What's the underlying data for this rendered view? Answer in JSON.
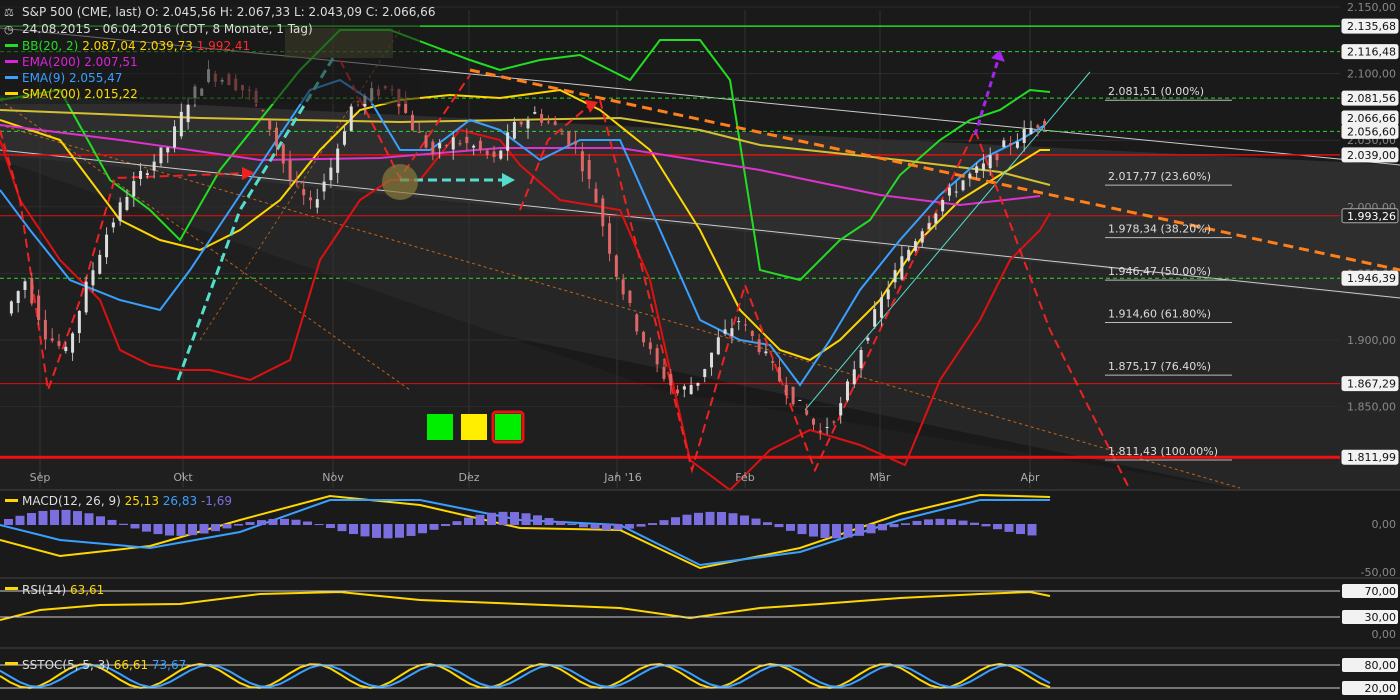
{
  "header": {
    "line1": "S&P 500 (CME, last)  O: 2.045,56  H: 2.067,33  L: 2.043,09  C: 2.066,66",
    "line2": "24.08.2015 - 06.04.2016 (CDT, 8 Monate, 1 Tag)",
    "legend": [
      {
        "label": "BB(20, 2)",
        "values": [
          "2.087,04",
          "2.039,73",
          "1.992,41"
        ],
        "colors": [
          "#ffd700",
          "#ffd700",
          "#ff2a2a"
        ],
        "swatch": "#22dd22"
      },
      {
        "label": "EMA(200)",
        "values": [
          "2.007,51"
        ],
        "colors": [
          "#dd22dd"
        ],
        "swatch": "#dd22dd"
      },
      {
        "label": "EMA(9)",
        "values": [
          "2.055,47"
        ],
        "colors": [
          "#3aa0ff"
        ],
        "swatch": "#3aa0ff"
      },
      {
        "label": "SMA(200)",
        "values": [
          "2.015,22"
        ],
        "colors": [
          "#ffd700"
        ],
        "swatch": "#ffd700"
      }
    ]
  },
  "colors": {
    "background": "#1a1a1a",
    "channel": "#3a3a3a",
    "bb_outer": "#22dd22",
    "bb_lower": "#dd1111",
    "ema9": "#3aa0ff",
    "ema200": "#dd33cc",
    "sma200": "#ffd700",
    "candle_up": "#bbbbbb",
    "candle_down": "#dd6666",
    "resistance_red": "#dd1111",
    "fib_green": "#33cc33",
    "trend_orange": "#ff7f1a",
    "arrow_cyan": "#55ddcc",
    "arrow_red": "#ee2222",
    "arrow_purple": "#aa22ee"
  },
  "axis": {
    "months": [
      "Sep",
      "Okt",
      "Nov",
      "Dez",
      "Jan '16",
      "Feb",
      "Mär",
      "Apr"
    ],
    "price_ticks": [
      "2.150,00",
      "2.100,00",
      "2.050,00",
      "2.000,00",
      "1.950,00",
      "1.900,00",
      "1.850,00"
    ],
    "price_tags": [
      {
        "label": "2.135,68",
        "style": "white"
      },
      {
        "label": "2.116,48",
        "style": "white"
      },
      {
        "label": "2.081,56",
        "style": "white"
      },
      {
        "label": "2.066,66",
        "style": "white"
      },
      {
        "label": "2.056,60",
        "style": "white"
      },
      {
        "label": "2.039,00",
        "style": "white"
      },
      {
        "label": "1.993,26",
        "style": "dark"
      },
      {
        "label": "1.946,39",
        "style": "white"
      },
      {
        "label": "1.867,29",
        "style": "white"
      },
      {
        "label": "1.811,99",
        "style": "white"
      }
    ]
  },
  "fib_levels": [
    {
      "label": "2.081,51 (0.00%)"
    },
    {
      "label": "2.017,77 (23.60%)"
    },
    {
      "label": "1.978,34 (38.20%)"
    },
    {
      "label": "1.946,47 (50.00%)"
    },
    {
      "label": "1.914,60 (61.80%)"
    },
    {
      "label": "1.875,17 (76.40%)"
    },
    {
      "label": "1.811,43 (100.00%)"
    }
  ],
  "signal_boxes": [
    "#00ee00",
    "#ffee00",
    "#00ee00"
  ],
  "panels": {
    "macd": {
      "title": "MACD(12, 26, 9)",
      "v1": "25,13",
      "v2": "26,83",
      "v3": "-1,69",
      "ticks": [
        "0,00",
        "-50,00"
      ]
    },
    "rsi": {
      "title": "RSI(14)",
      "v1": "63,61",
      "ticks": [
        "70,00",
        "30,00",
        "0,00"
      ]
    },
    "sstoc": {
      "title": "SSTOC(5, 5, 3)",
      "v1": "66,61",
      "v2": "73,67",
      "ticks": [
        "80,00",
        "20,00"
      ]
    }
  },
  "chart_data": {
    "type": "candlestick",
    "symbol": "S&P 500 (CME, last)",
    "ylim": [
      1800,
      2150
    ],
    "x_months": [
      "Sep",
      "Okt",
      "Nov",
      "Dez",
      "Jan '16",
      "Feb",
      "Mär",
      "Apr"
    ],
    "close_path": [
      1920,
      1945,
      1905,
      1890,
      1940,
      1980,
      2010,
      2030,
      2045,
      2080,
      2100,
      2095,
      2085,
      2060,
      2020,
      2000,
      2030,
      2075,
      2085,
      2090,
      2060,
      2040,
      2050,
      2045,
      2035,
      2060,
      2070,
      2060,
      2045,
      2005,
      1950,
      1910,
      1880,
      1860,
      1870,
      1900,
      1915,
      1895,
      1870,
      1850,
      1830,
      1850,
      1895,
      1930,
      1960,
      1985,
      2005,
      2020,
      2030,
      2045,
      2055,
      2066.66
    ],
    "horizontal_levels": [
      2135.68,
      2116.48,
      2081.56,
      2066.66,
      2056.6,
      2039.0,
      1993.26,
      1946.39,
      1867.29,
      1811.99
    ],
    "fibonacci": [
      2081.51,
      2017.77,
      1978.34,
      1946.47,
      1914.6,
      1875.17,
      1811.43
    ],
    "last": {
      "open": 2045.56,
      "high": 2067.33,
      "low": 2043.09,
      "close": 2066.66
    }
  }
}
